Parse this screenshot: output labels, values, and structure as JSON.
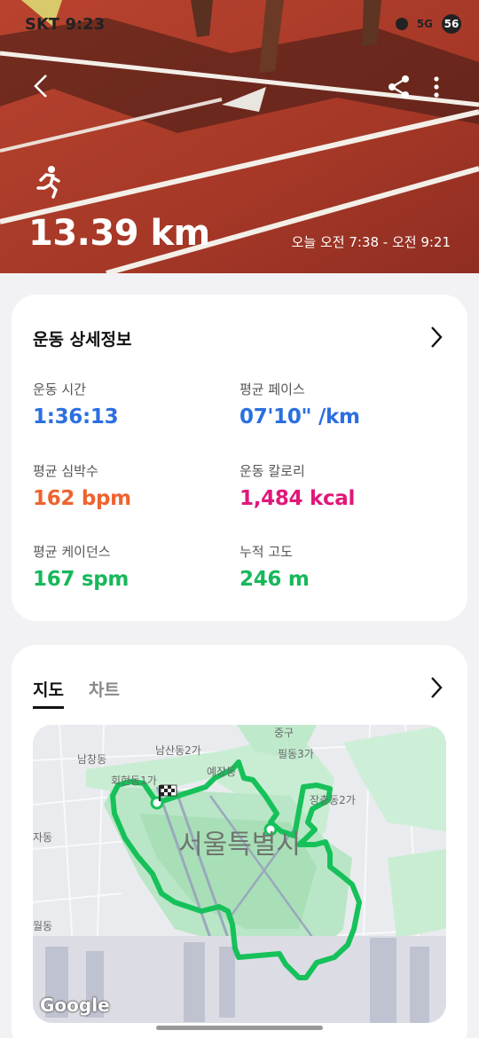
{
  "status_bar": {
    "time": "SKT 9:23",
    "network": "5G",
    "battery": "56"
  },
  "hero": {
    "distance": "13.39 km",
    "timespan": "오늘 오전 7:38 - 오전 9:21",
    "activity_icon": "running-icon"
  },
  "details": {
    "title": "운동 상세정보",
    "stats": [
      {
        "label": "운동 시간",
        "value": "1:36:13",
        "color": "#2b6fe0"
      },
      {
        "label": "평균 페이스",
        "value": "07'10\" /km",
        "color": "#2b6fe0"
      },
      {
        "label": "평균 심박수",
        "value": "162 bpm",
        "color": "#ee6330"
      },
      {
        "label": "운동 칼로리",
        "value": "1,484 kcal",
        "color": "#e0187a"
      },
      {
        "label": "평균 케이던스",
        "value": "167 spm",
        "color": "#17b85a"
      },
      {
        "label": "누적 고도",
        "value": "246 m",
        "color": "#17b85a"
      }
    ]
  },
  "map_section": {
    "tabs": [
      {
        "label": "지도"
      },
      {
        "label": "차트"
      }
    ],
    "labels": {
      "namchang": "남창동",
      "namsan": "남산동2가",
      "junggu": "중구",
      "pildong": "필동3가",
      "hoehyeon": "회현동1가",
      "yejang": "예장동",
      "jangchung": "장충동2가",
      "jadong": "자동",
      "seoul": "서울특별시",
      "woldong": "월동"
    },
    "attribution": "Google",
    "route_color": "#16c15a"
  }
}
